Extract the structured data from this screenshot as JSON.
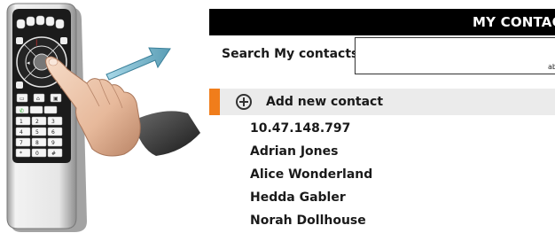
{
  "panel": {
    "title": "MY CONTACTS",
    "search_label": "Search My contacts",
    "search_hint": "ab",
    "add_contact_label": "Add new contact",
    "accent_color": "#f07d1b",
    "header_color": "#000000",
    "contacts": [
      {
        "name": "10.47.148.797"
      },
      {
        "name": "Adrian Jones"
      },
      {
        "name": "Alice Wonderland"
      },
      {
        "name": "Hedda Gabler"
      },
      {
        "name": "Norah Dollhouse"
      }
    ]
  },
  "illustration": {
    "remote_button_labels": [
      "1",
      "2",
      "3",
      "4",
      "5",
      "6",
      "7",
      "8",
      "9",
      "*",
      "0",
      "#"
    ],
    "icons": [
      "remote-control-icon",
      "pointing-hand-icon",
      "arrow-icon"
    ]
  }
}
